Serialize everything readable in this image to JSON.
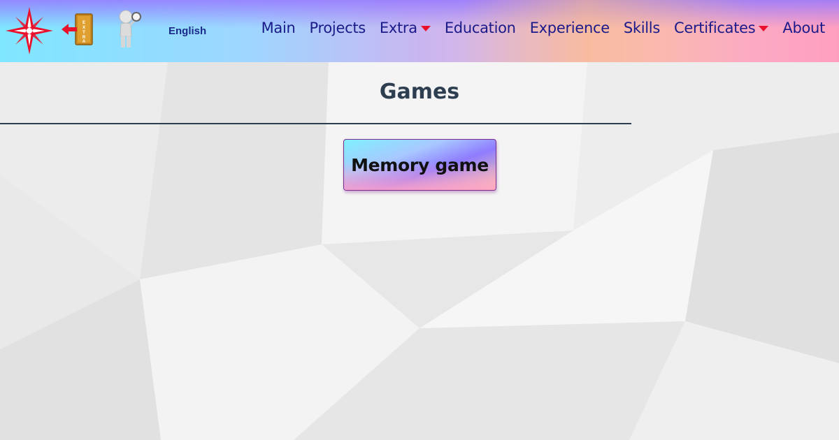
{
  "header": {
    "language_label": "English",
    "nav": [
      {
        "label": "Main",
        "dropdown": false
      },
      {
        "label": "Projects",
        "dropdown": false
      },
      {
        "label": "Extra",
        "dropdown": true
      },
      {
        "label": "Education",
        "dropdown": false
      },
      {
        "label": "Experience",
        "dropdown": false
      },
      {
        "label": "Skills",
        "dropdown": false
      },
      {
        "label": "Certificates",
        "dropdown": true
      },
      {
        "label": "About",
        "dropdown": false
      }
    ],
    "icons": {
      "logo": "compass-star-icon",
      "extra": "extra-exit-icon",
      "person": "person-magnifier-icon"
    }
  },
  "main": {
    "title": "Games",
    "games": [
      {
        "label": "Memory game"
      }
    ]
  },
  "colors": {
    "nav_text": "#1a1a8a",
    "caret": "#e8102a",
    "title": "#2c3e50",
    "button_border": "#7b2d8e",
    "page_bg": "#f2f2f2"
  }
}
